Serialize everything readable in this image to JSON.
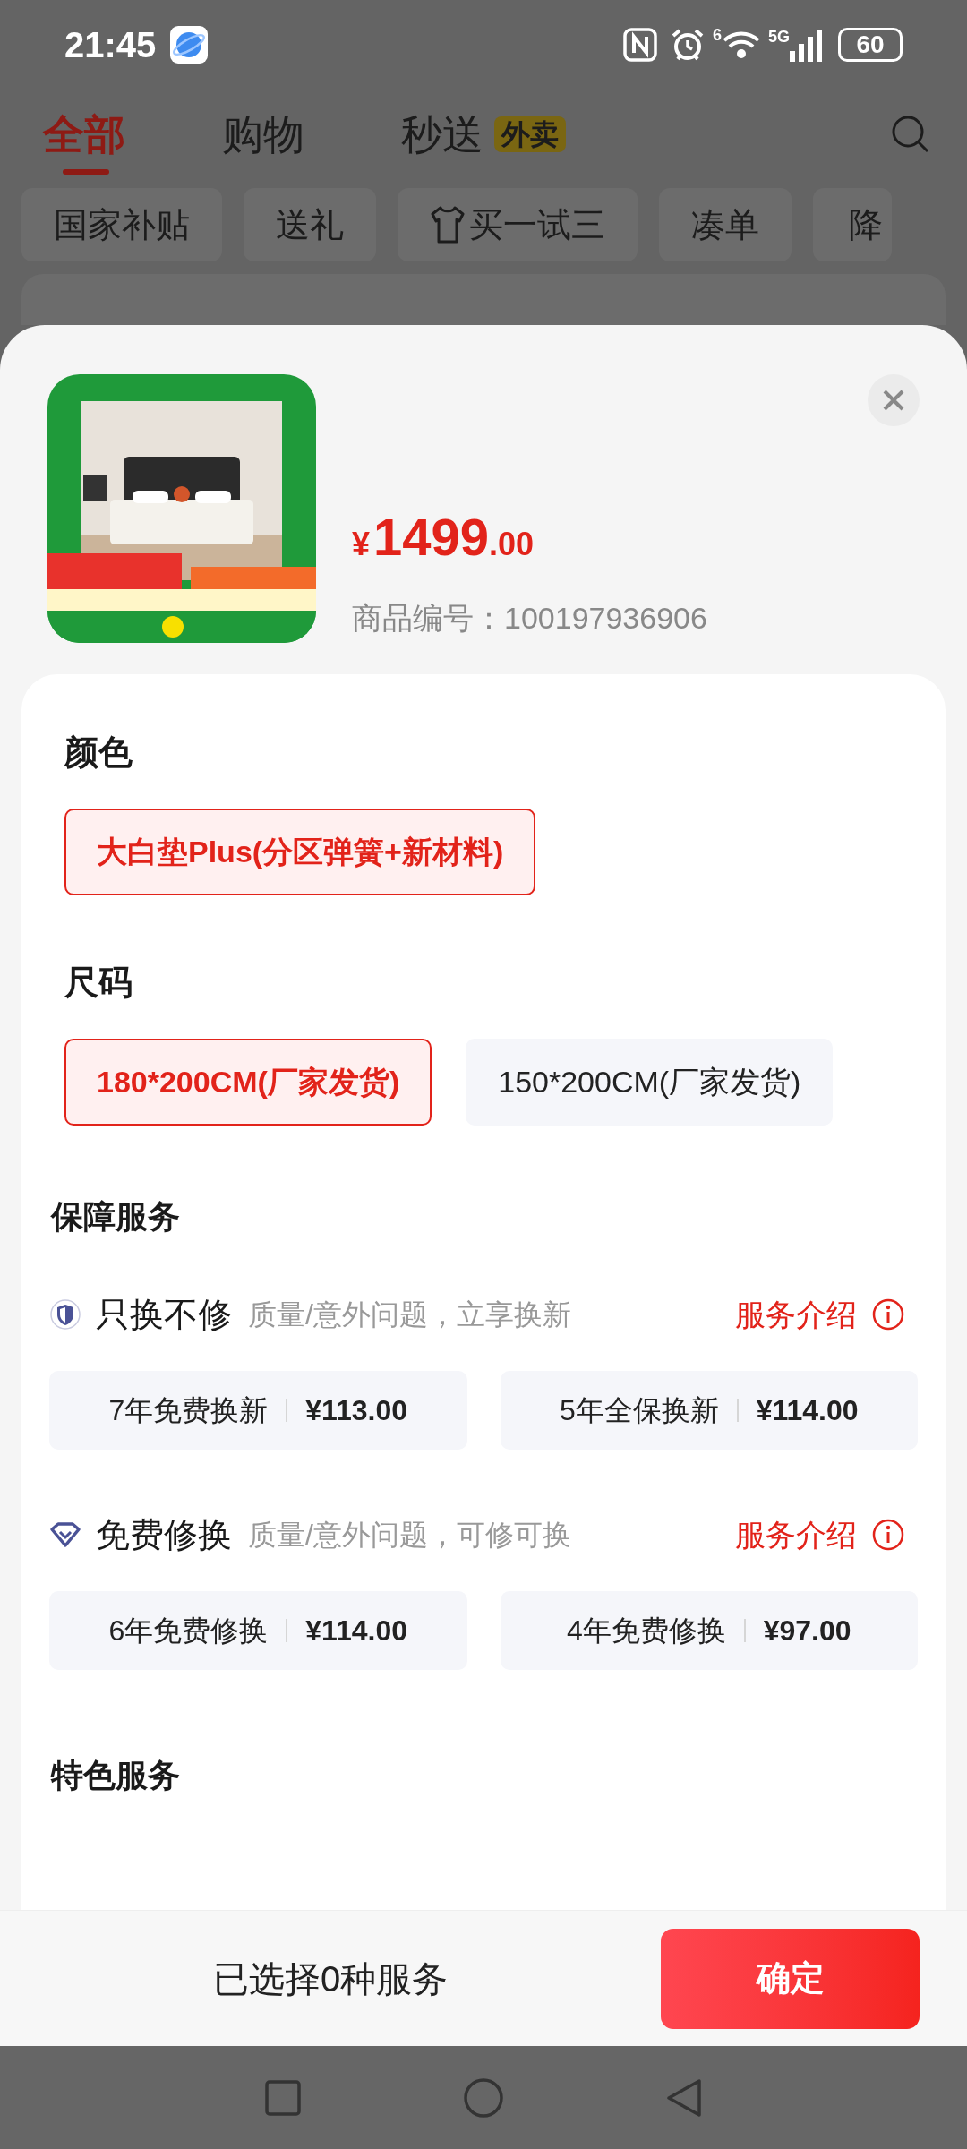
{
  "status_bar": {
    "time": "21:45",
    "wifi_label": "6",
    "network": "5G",
    "battery": "60"
  },
  "top_tabs": [
    {
      "label": "全部",
      "selected": true
    },
    {
      "label": "购物",
      "selected": false
    },
    {
      "label": "秒送",
      "badge": "外卖",
      "selected": false
    }
  ],
  "chips": [
    {
      "kind": "text",
      "label": "国家补贴"
    },
    {
      "kind": "text",
      "label": "送礼"
    },
    {
      "kind": "icon",
      "label": "买一试三"
    },
    {
      "kind": "text",
      "label": "凑单"
    },
    {
      "kind": "text",
      "label": "降"
    }
  ],
  "product": {
    "currency": "¥",
    "price": "1499",
    "price_decimal": ".00",
    "sku": "商品编号：100197936906"
  },
  "specs": [
    {
      "title": "颜色",
      "options": [
        {
          "label": "大白垫Plus(分区弹簧+新材料)",
          "selected": true
        }
      ]
    },
    {
      "title": "尺码",
      "options": [
        {
          "label": "180*200CM(厂家发货)",
          "selected": true
        },
        {
          "label": "150*200CM(厂家发货)",
          "selected": false
        }
      ]
    }
  ],
  "guarantee": {
    "title": "保障服务",
    "groups": [
      {
        "kind": "shield",
        "name": "只换不修",
        "desc": "质量/意外问题，立享换新",
        "link": "服务介绍",
        "options": [
          {
            "name": "7年免费换新",
            "price": "¥113.00",
            "selected": false
          },
          {
            "name": "5年全保换新",
            "price": "¥114.00",
            "selected": false
          }
        ]
      },
      {
        "kind": "diamond",
        "name": "免费修换",
        "desc": "质量/意外问题，可修可换",
        "link": "服务介绍",
        "options": [
          {
            "name": "6年免费修换",
            "price": "¥114.00",
            "selected": false
          },
          {
            "name": "4年免费修换",
            "price": "¥97.00",
            "selected": false
          }
        ]
      }
    ]
  },
  "featured": {
    "title": "特色服务"
  },
  "footer": {
    "summary": "已选择0种服务",
    "confirm": "确定"
  }
}
